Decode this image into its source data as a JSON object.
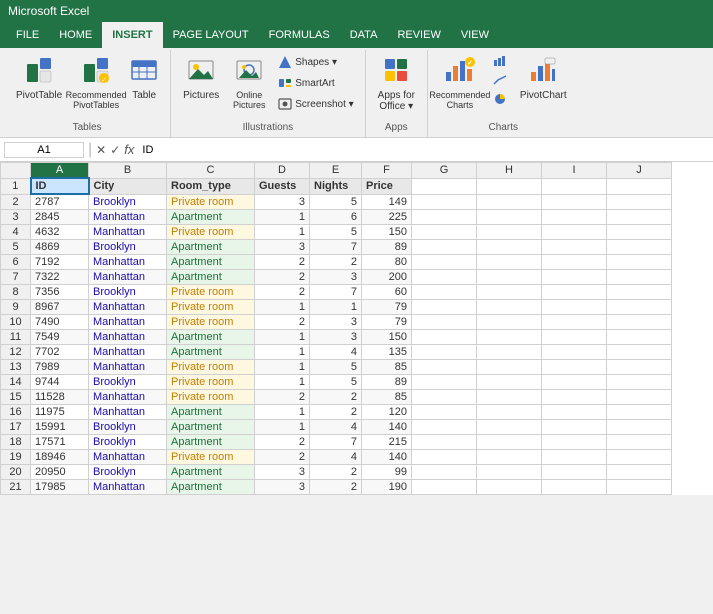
{
  "app": {
    "title": "Microsoft Excel"
  },
  "tabs": [
    {
      "label": "FILE",
      "active": false
    },
    {
      "label": "HOME",
      "active": false
    },
    {
      "label": "INSERT",
      "active": true
    },
    {
      "label": "PAGE LAYOUT",
      "active": false
    },
    {
      "label": "FORMULAS",
      "active": false
    },
    {
      "label": "DATA",
      "active": false
    },
    {
      "label": "REVIEW",
      "active": false
    },
    {
      "label": "VIEW",
      "active": false
    }
  ],
  "ribbon": {
    "groups": [
      {
        "label": "Tables",
        "buttons": [
          {
            "id": "pivot-table",
            "icon": "📊",
            "label": "PivotTable",
            "type": "large"
          },
          {
            "id": "recommended-pivot",
            "icon": "📋",
            "label": "Recommended\nPivotTables",
            "type": "large"
          },
          {
            "id": "table",
            "icon": "📄",
            "label": "Table",
            "type": "large"
          }
        ]
      },
      {
        "label": "Illustrations",
        "buttons": [
          {
            "id": "pictures",
            "icon": "🖼",
            "label": "Pictures",
            "type": "large"
          },
          {
            "id": "online-pictures",
            "icon": "🌐",
            "label": "Online\nPictures",
            "type": "large"
          },
          {
            "id": "shapes",
            "icon": "⬡",
            "label": "Shapes ▾",
            "type": "small-group"
          },
          {
            "id": "smartart",
            "icon": "🔷",
            "label": "SmartArt",
            "type": "small-group"
          },
          {
            "id": "screenshot",
            "icon": "📷",
            "label": "Screenshot ▾",
            "type": "small-group"
          }
        ]
      },
      {
        "label": "Apps",
        "buttons": [
          {
            "id": "apps-office",
            "icon": "🔲",
            "label": "Apps for\nOffice ▾",
            "type": "large"
          }
        ]
      },
      {
        "label": "Charts",
        "buttons": [
          {
            "id": "recommended-charts",
            "icon": "📈",
            "label": "Recommended\nCharts",
            "type": "large"
          },
          {
            "id": "pivot-chart",
            "icon": "📉",
            "label": "PivotChart",
            "type": "large"
          }
        ]
      }
    ]
  },
  "formula_bar": {
    "name_box": "A1",
    "formula": "ID"
  },
  "spreadsheet": {
    "col_headers": [
      "",
      "A",
      "B",
      "C",
      "D",
      "E",
      "F",
      "G",
      "H",
      "I",
      "J"
    ],
    "row_headers": [
      "1",
      "2",
      "3",
      "4",
      "5",
      "6",
      "7",
      "8",
      "9",
      "10",
      "11",
      "12",
      "13",
      "14",
      "15",
      "16",
      "17",
      "18",
      "19",
      "20",
      "21"
    ],
    "data": [
      [
        "ID",
        "City",
        "Room_type",
        "Guests",
        "Nights",
        "Price"
      ],
      [
        "2787",
        "Brooklyn",
        "Private room",
        "3",
        "5",
        "149"
      ],
      [
        "2845",
        "Manhattan",
        "Apartment",
        "1",
        "6",
        "225"
      ],
      [
        "4632",
        "Manhattan",
        "Private room",
        "1",
        "5",
        "150"
      ],
      [
        "4869",
        "Brooklyn",
        "Apartment",
        "3",
        "7",
        "89"
      ],
      [
        "7192",
        "Manhattan",
        "Apartment",
        "2",
        "2",
        "80"
      ],
      [
        "7322",
        "Manhattan",
        "Apartment",
        "2",
        "3",
        "200"
      ],
      [
        "7356",
        "Brooklyn",
        "Private room",
        "2",
        "7",
        "60"
      ],
      [
        "8967",
        "Manhattan",
        "Private room",
        "1",
        "1",
        "79"
      ],
      [
        "7490",
        "Manhattan",
        "Private room",
        "2",
        "3",
        "79"
      ],
      [
        "7549",
        "Manhattan",
        "Apartment",
        "1",
        "3",
        "150"
      ],
      [
        "7702",
        "Manhattan",
        "Apartment",
        "1",
        "4",
        "135"
      ],
      [
        "7989",
        "Manhattan",
        "Private room",
        "1",
        "5",
        "85"
      ],
      [
        "9744",
        "Brooklyn",
        "Private room",
        "1",
        "5",
        "89"
      ],
      [
        "11528",
        "Manhattan",
        "Private room",
        "2",
        "2",
        "85"
      ],
      [
        "11975",
        "Manhattan",
        "Apartment",
        "1",
        "2",
        "120"
      ],
      [
        "15991",
        "Brooklyn",
        "Apartment",
        "1",
        "4",
        "140"
      ],
      [
        "17571",
        "Brooklyn",
        "Apartment",
        "2",
        "7",
        "215"
      ],
      [
        "18946",
        "Manhattan",
        "Private room",
        "2",
        "4",
        "140"
      ],
      [
        "20950",
        "Brooklyn",
        "Apartment",
        "3",
        "2",
        "99"
      ],
      [
        "17985",
        "Manhattan",
        "Apartment",
        "3",
        "2",
        "190"
      ]
    ]
  }
}
